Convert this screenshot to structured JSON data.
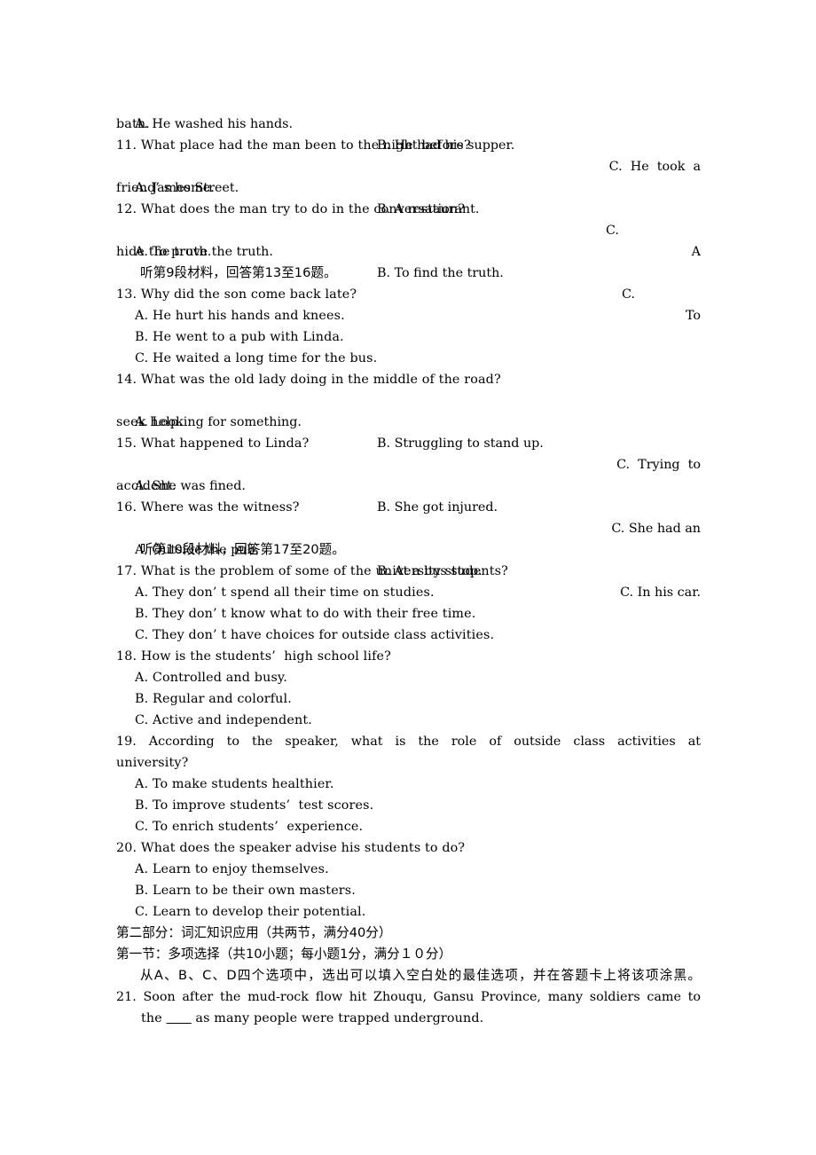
{
  "document": {
    "type": "exam-paper",
    "language": "zh-CN + en",
    "page_background": "#ffffff",
    "text_color": "#000000"
  },
  "lines": {
    "q10_options_a": "A. He washed his hands.",
    "q10_options_b": "B. He had his supper.",
    "q10_options_c": "C.  He  took  a",
    "q10_options_cont": "bath.",
    "q11_stem": "11. What place had the man been to the night before?",
    "q11_a": "A. James Street.",
    "q11_b": "B. A restaurant.",
    "q11_c": "C.",
    "q11_c_tail": "A",
    "q11_cont": "friend’ s home.",
    "q12_stem": "12. What does the man try to do in the conversation?",
    "q12_a": "A. To prove the truth.",
    "q12_b": "B. To find the truth.",
    "q12_c": "C.",
    "q12_c_tail": "To",
    "q12_cont": "hide the truth.",
    "listen_9": "听第9段材料，回答第13至16题。",
    "q13_stem": "13. Why did the son come back late?",
    "q13_a": "A. He hurt his hands and knees.",
    "q13_b": "B. He went to a pub with Linda.",
    "q13_c": "C. He waited a long time for the bus.",
    "q14_stem": "14. What was the old lady doing in the middle of the road?",
    "q14_a": "A. Looking for something.",
    "q14_b": "B. Struggling to stand up.",
    "q14_c": "C.  Trying  to",
    "q14_cont": "seek help.",
    "q15_stem": "15. What happened to Linda?",
    "q15_a": "A. She was fined.",
    "q15_b": "B. She got injured.",
    "q15_c": "C. She had an",
    "q15_cont": "accident.",
    "q16_stem": "16. Where was the witness?",
    "q16_a": "A. Outside the pub.",
    "q16_b": "B. At a bus stop.",
    "q16_c": "C. In his car.",
    "listen_10": "听第10段材料，回答第17至20题。",
    "q17_stem": "17. What is the problem of some of the university students?",
    "q17_a": "A. They don’ t spend all their time on studies.",
    "q17_b": "B. They don’ t know what to do with their free time.",
    "q17_c": "C. They don’ t have choices for outside class activities.",
    "q18_stem": "18. How is the students’  high school life?",
    "q18_a": "A. Controlled and busy.",
    "q18_b": "B. Regular and colorful.",
    "q18_c": "C. Active and independent.",
    "q19_stem": "19. According to the speaker, what is the role of outside class activities at",
    "q19_stem_cont": "university?",
    "q19_a": "A. To make students healthier.",
    "q19_b": "B. To improve students’  test scores.",
    "q19_c": "C. To enrich students’  experience.",
    "q20_stem": "20. What does the speaker advise his students to do?",
    "q20_a": "A. Learn to enjoy themselves.",
    "q20_b": "B. Learn to be their own masters.",
    "q20_c": "C. Learn to develop their potential.",
    "part2_heading": "第二部分：词汇知识应用（共两节，满分40分）",
    "section1_heading": "第一节：多项选择（共10小题；每小题1分，满分１０分）",
    "section1_instruction": "从A、B、C、D四个选项中，选出可以填入空白处的最佳选项，并在答题卡上将该项涂黑。",
    "q21_line1": "21. Soon after the mud-rock flow hit Zhouqu, Gansu Province, many soldiers came to",
    "q21_line2_pre": "the ",
    "q21_line2_blank": "      ",
    "q21_line2_post": " as many people were trapped underground."
  }
}
